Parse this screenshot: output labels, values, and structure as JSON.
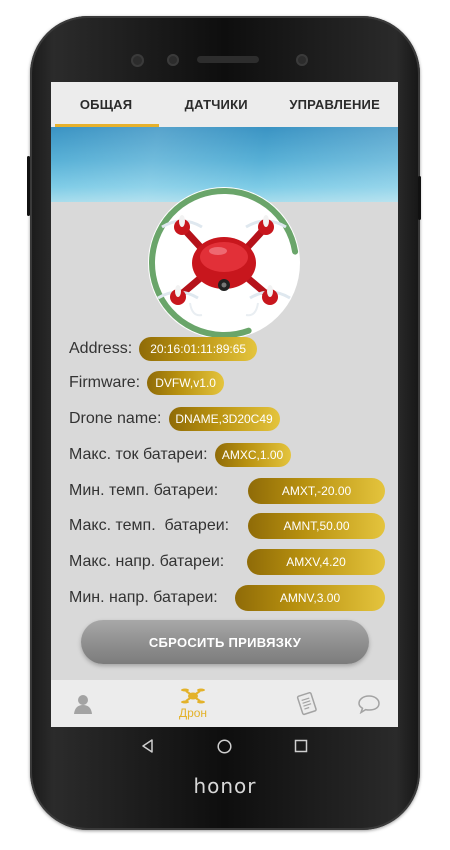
{
  "device": {
    "brand": "honor"
  },
  "tabs": [
    {
      "label": "ОБЩАЯ",
      "active": true
    },
    {
      "label": "ДАТЧИКИ",
      "active": false
    },
    {
      "label": "УПРАВЛЕНИЕ",
      "active": false
    }
  ],
  "info": {
    "address_label": "Address:",
    "address_value": "20:16:01:11:89:65",
    "firmware_label": "Firmware:",
    "firmware_value": "DVFW,v1.0",
    "drone_name_label": "Drone name:",
    "drone_name_value": "DNAME,3D20C49",
    "max_current_label": "Макс. ток батареи:",
    "max_current_value": "AMXC,1.00",
    "min_temp_label": "Мин. темп. батареи:",
    "min_temp_value": "AMXT,-20.00",
    "max_temp_label": "Макс. темп.  батареи:",
    "max_temp_value": "AMNT,50.00",
    "max_voltage_label": "Макс. напр. батареи:",
    "max_voltage_value": "AMXV,4.20",
    "min_voltage_label": "Мин. напр. батареи:",
    "min_voltage_value": "AMNV,3.00"
  },
  "actions": {
    "reset_binding": "СБРОСИТЬ ПРИВЯЗКУ"
  },
  "bottom_nav": {
    "items": [
      {
        "icon": "person-icon",
        "label": ""
      },
      {
        "icon": "drone-icon",
        "label": "Дрон",
        "active": true
      },
      {
        "icon": "document-icon",
        "label": ""
      },
      {
        "icon": "chat-bubble-icon",
        "label": ""
      }
    ]
  },
  "colors": {
    "accent": "#e7b12c",
    "pill_dark": "#8f6b08",
    "pill_light": "#e4c43d",
    "progress_ring": "#6aa56a",
    "drone_red": "#c8161d"
  },
  "status": {
    "avatar_ring_progress": 0.78
  }
}
